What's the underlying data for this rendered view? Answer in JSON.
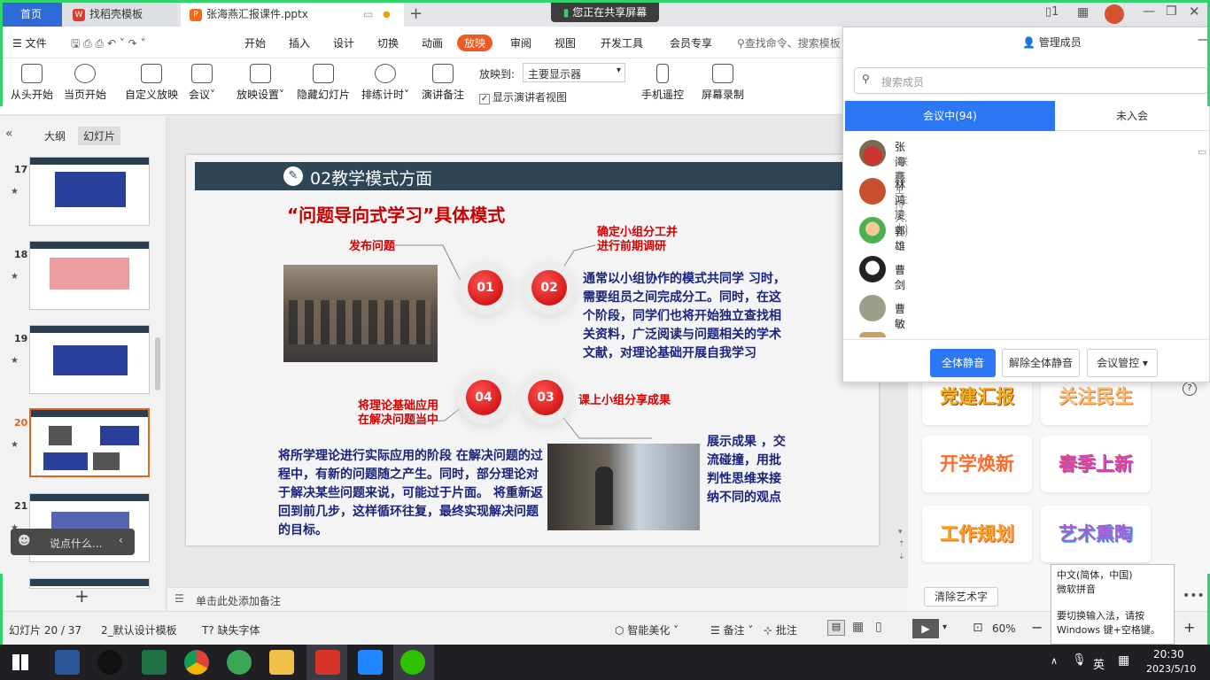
{
  "tabs": {
    "home": "首页",
    "template": "找稻壳模板",
    "document": "张海燕汇报课件.pptx"
  },
  "sharing_banner": "您正在共享屏幕",
  "menu": {
    "file": "文件",
    "items": [
      "开始",
      "插入",
      "设计",
      "切换",
      "动画",
      "放映",
      "审阅",
      "视图",
      "开发工具",
      "会员专享"
    ],
    "search_placeholder": "查找命令、搜索模板"
  },
  "ribbon": {
    "from_start": "从头开始",
    "from_current": "当页开始",
    "custom_show": "自定义放映",
    "meeting": "会议",
    "show_settings": "放映设置",
    "hide_slide": "隐藏幻灯片",
    "rehearse": "排练计时",
    "presenter_notes": "演讲备注",
    "show_on_label": "放映到:",
    "show_on_value": "主要显示器",
    "presenter_view": "显示演讲者视图",
    "phone_remote": "手机遥控",
    "screen_record": "屏幕录制"
  },
  "left_panel": {
    "outline_tab": "大纲",
    "slides_tab": "幻灯片",
    "slide_numbers": [
      "17",
      "18",
      "19",
      "20",
      "21"
    ],
    "comment_placeholder": "说点什么..."
  },
  "slide": {
    "header": "02教学模式方面",
    "title": "“问题导向式学习”具体模式",
    "step1_label": "发布问题",
    "step2_label": "确定小组分工并\n进行前期调研",
    "step3_label": "课上小组分享成果",
    "step4_label": "将理论基础应用\n在解决问题当中",
    "num1": "01",
    "num2": "02",
    "num3": "03",
    "num4": "04",
    "step2_text": "通常以小组协作的模式共同学 习时，需要组员之间完成分工。同时，在这个阶段，同学们也将开始独立查找相关资料，广泛阅读与问题相关的学术文献，对理论基础开展自我学习",
    "step4_text": "将所学理论进行实际应用的阶段 在解决问题的过程中，有新的问题随之产生。同时，部分理论对于解决某些问题来说，可能过于片面。 将重新返回到前几步，这样循环往复，最终实现解决问题的目标。",
    "step3_text": "展示成果 ，交流碰撞，用批判性思维来接纳不同的观点"
  },
  "notes_placeholder": "单击此处添加备注",
  "art_words": {
    "items": [
      "党建汇报",
      "关注民生",
      "开学焕新",
      "春季上新",
      "工作规划",
      "艺术熏陶"
    ],
    "clear": "清除艺术字"
  },
  "status": {
    "slide_count": "幻灯片 20 / 37",
    "template": "2_默认设计模板",
    "missing_font": "缺失字体",
    "smart_beautify": "智能美化",
    "notes": "备注",
    "comments": "批注",
    "zoom": "60%"
  },
  "members_panel": {
    "title": "管理成员",
    "search_placeholder": "搜索成员",
    "tab_in_meeting": "会议中(94)",
    "tab_not_joined": "未入会",
    "members": [
      {
        "name": "张海燕",
        "role": "(联席主持人, 我)"
      },
      {
        "name": "林鸿凌",
        "role": "(主持人)"
      },
      {
        "name": "郭雄",
        "role": ""
      },
      {
        "name": "曹剑",
        "role": ""
      },
      {
        "name": "曹敏",
        "role": ""
      }
    ],
    "mute_all": "全体静音",
    "unmute_all": "解除全体静音",
    "meeting_manage": "会议管控"
  },
  "ime_tooltip": {
    "line1": "中文(简体，中国)",
    "line2": "微软拼音",
    "line3": "要切换输入法，请按",
    "line4": "Windows 键+空格键。"
  },
  "tray": {
    "ime": "英",
    "time": "20:30",
    "date": "2023/5/10"
  }
}
